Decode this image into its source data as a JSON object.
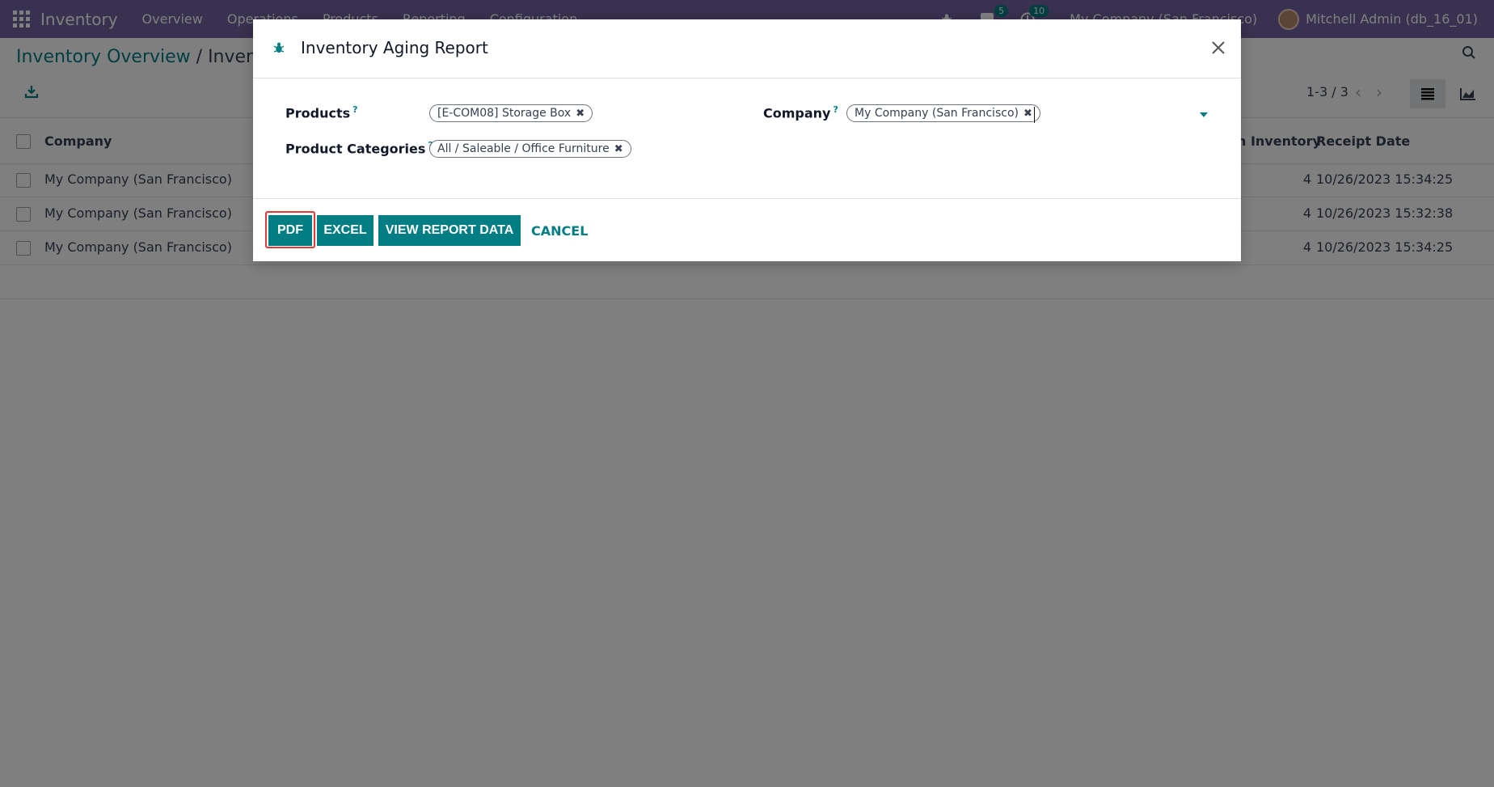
{
  "navbar": {
    "app_name": "Inventory",
    "menu": [
      "Overview",
      "Operations",
      "Products",
      "Reporting",
      "Configuration"
    ],
    "messages_count": "5",
    "activities_count": "10",
    "company": "My Company (San Francisco)",
    "user": "Mitchell Admin (db_16_01)"
  },
  "breadcrumb": {
    "parent": "Inventory Overview",
    "separator": " / ",
    "current": "Invento"
  },
  "pager": {
    "text": "1-3 / 3"
  },
  "list": {
    "headers": {
      "company": "Company",
      "inventory": "n Inventory",
      "receipt_date": "Receipt Date"
    },
    "rows": [
      {
        "company": "My Company (San Francisco)",
        "qty": "4",
        "date": "10/26/2023 15:34:25"
      },
      {
        "company": "My Company (San Francisco)",
        "qty": "4",
        "date": "10/26/2023 15:32:38"
      },
      {
        "company": "My Company (San Francisco)",
        "qty": "4",
        "date": "10/26/2023 15:34:25"
      }
    ]
  },
  "modal": {
    "title": "Inventory Aging Report",
    "products_label": "Products",
    "categories_label": "Product Categories",
    "company_label": "Company",
    "help_mark": "?",
    "product_tag": "[E-COM08] Storage Box",
    "category_tag": "All / Saleable / Office Furniture",
    "company_tag": "My Company (San Francisco)",
    "tag_remove": "✖",
    "buttons": {
      "pdf": "PDF",
      "excel": "EXCEL",
      "view": "VIEW REPORT DATA",
      "cancel": "CANCEL"
    }
  },
  "colors": {
    "navbar": "#71639e",
    "accent": "#017e84",
    "highlight": "#e53935"
  },
  "icons": [
    "apps-grid-icon",
    "bug-icon",
    "chat-icon",
    "clock-icon",
    "download-icon",
    "search-icon",
    "list-view-icon",
    "graph-view-icon",
    "close-icon",
    "chevron-left-icon",
    "chevron-right-icon",
    "caret-down-icon"
  ]
}
